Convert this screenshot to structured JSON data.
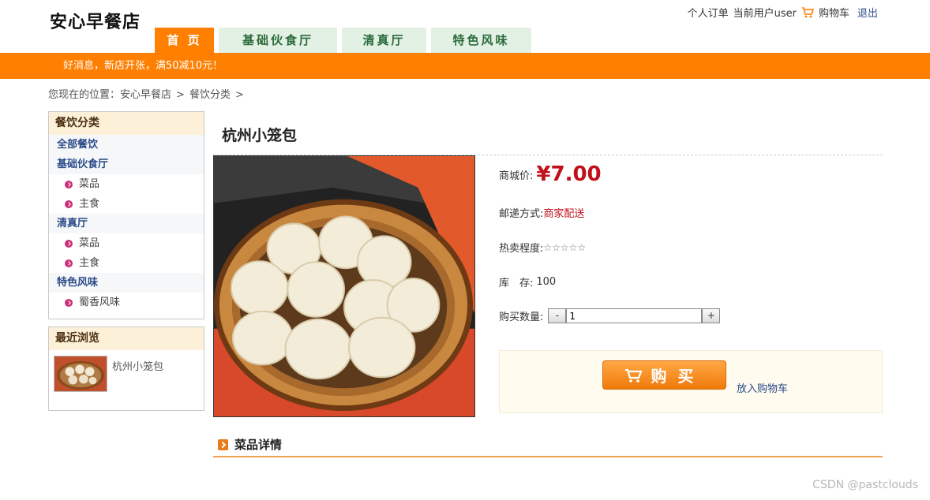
{
  "header": {
    "logo": "安心早餐店",
    "links": {
      "orders": "个人订单",
      "current_user": "当前用户user",
      "cart": "购物车",
      "logout": "退出"
    }
  },
  "nav": {
    "tabs": [
      {
        "label": "首 页",
        "active": true
      },
      {
        "label": "基础伙食厅",
        "active": false
      },
      {
        "label": "清真厅",
        "active": false
      },
      {
        "label": "特色风味",
        "active": false
      }
    ]
  },
  "banner": {
    "text": "好消息，新店开张，满50减10元！"
  },
  "breadcrumb": {
    "prefix": "您现在的位置：",
    "items": [
      "安心早餐店",
      "餐饮分类"
    ],
    "separator": ">"
  },
  "sidebar": {
    "categories_title": "餐饮分类",
    "all_label": "全部餐饮",
    "groups": [
      {
        "name": "基础伙食厅",
        "subs": [
          "菜品",
          "主食"
        ]
      },
      {
        "name": "清真厅",
        "subs": [
          "菜品",
          "主食"
        ]
      },
      {
        "name": "特色风味",
        "subs": [
          "蜀香风味"
        ]
      }
    ],
    "recent_title": "最近浏览",
    "recent_items": [
      {
        "name": "杭州小笼包"
      }
    ]
  },
  "product": {
    "name": "杭州小笼包",
    "price_label": "商城价:",
    "price": "¥7.00",
    "shipping_label": "邮递方式:",
    "shipping": "商家配送",
    "popularity_label": "热卖程度:",
    "popularity_stars": "☆☆☆☆☆",
    "stock_label": "库　存:",
    "stock": "100",
    "qty_label": "购买数量:",
    "qty_minus": "-",
    "qty_value": "1",
    "qty_plus": "+",
    "buy_label": "购买",
    "add_cart_label": "放入购物车"
  },
  "details": {
    "title": "菜品详情"
  },
  "watermark": "CSDN @pastclouds",
  "colors": {
    "accent": "#ff7f00",
    "tab_bg": "#e3f1e4",
    "tab_text": "#2a6a3a",
    "price": "#c0111a",
    "link": "#2b4b88"
  }
}
